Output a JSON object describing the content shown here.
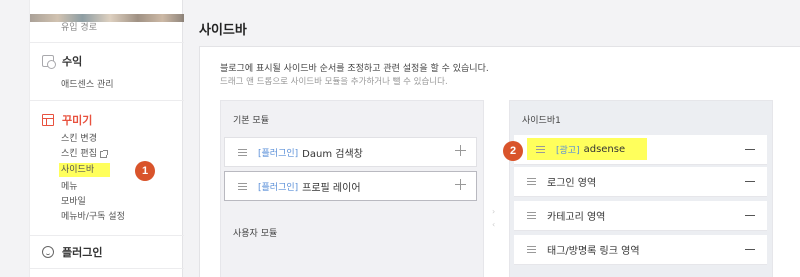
{
  "nav": {
    "top_label": "유입 경로",
    "revenue": {
      "title": "수익",
      "items": [
        "애드센스 관리"
      ]
    },
    "customize": {
      "title": "꾸미기",
      "items": [
        "스킨 변경",
        "스킨 편집",
        "사이드바",
        "메뉴",
        "모바일",
        "메뉴바/구독 설정"
      ]
    },
    "plugin": {
      "title": "플러그인"
    }
  },
  "main": {
    "title": "사이드바",
    "desc": "블로그에 표시될 사이드바 순서를 조정하고 관련 설정을 할 수 있습니다.",
    "desc_sub": "드래그 앤 드롭으로 사이드바 모듈을 추가하거나 뺄 수 있습니다.",
    "basic_modules": {
      "title": "기본 모듈",
      "items": [
        {
          "tag": "[플러그인]",
          "label": "Daum 검색창"
        },
        {
          "tag": "[플러그인]",
          "label": "프로필 레이어"
        }
      ]
    },
    "user_modules": {
      "title": "사용자 모듈"
    },
    "sidebar1": {
      "title": "사이드바1",
      "items": [
        {
          "tag": "[광고]",
          "label": "adsense"
        },
        {
          "tag": "",
          "label": "로그인 영역"
        },
        {
          "tag": "",
          "label": "카테고리 영역"
        },
        {
          "tag": "",
          "label": "태그/방명록 링크 영역"
        }
      ]
    }
  },
  "annotations": {
    "badge1": "1",
    "badge2": "2"
  },
  "colors": {
    "accent_red": "#e8523f",
    "highlight_yellow": "#ffff5c",
    "badge": "#d9542b",
    "tag_blue": "#5a8fd8"
  }
}
